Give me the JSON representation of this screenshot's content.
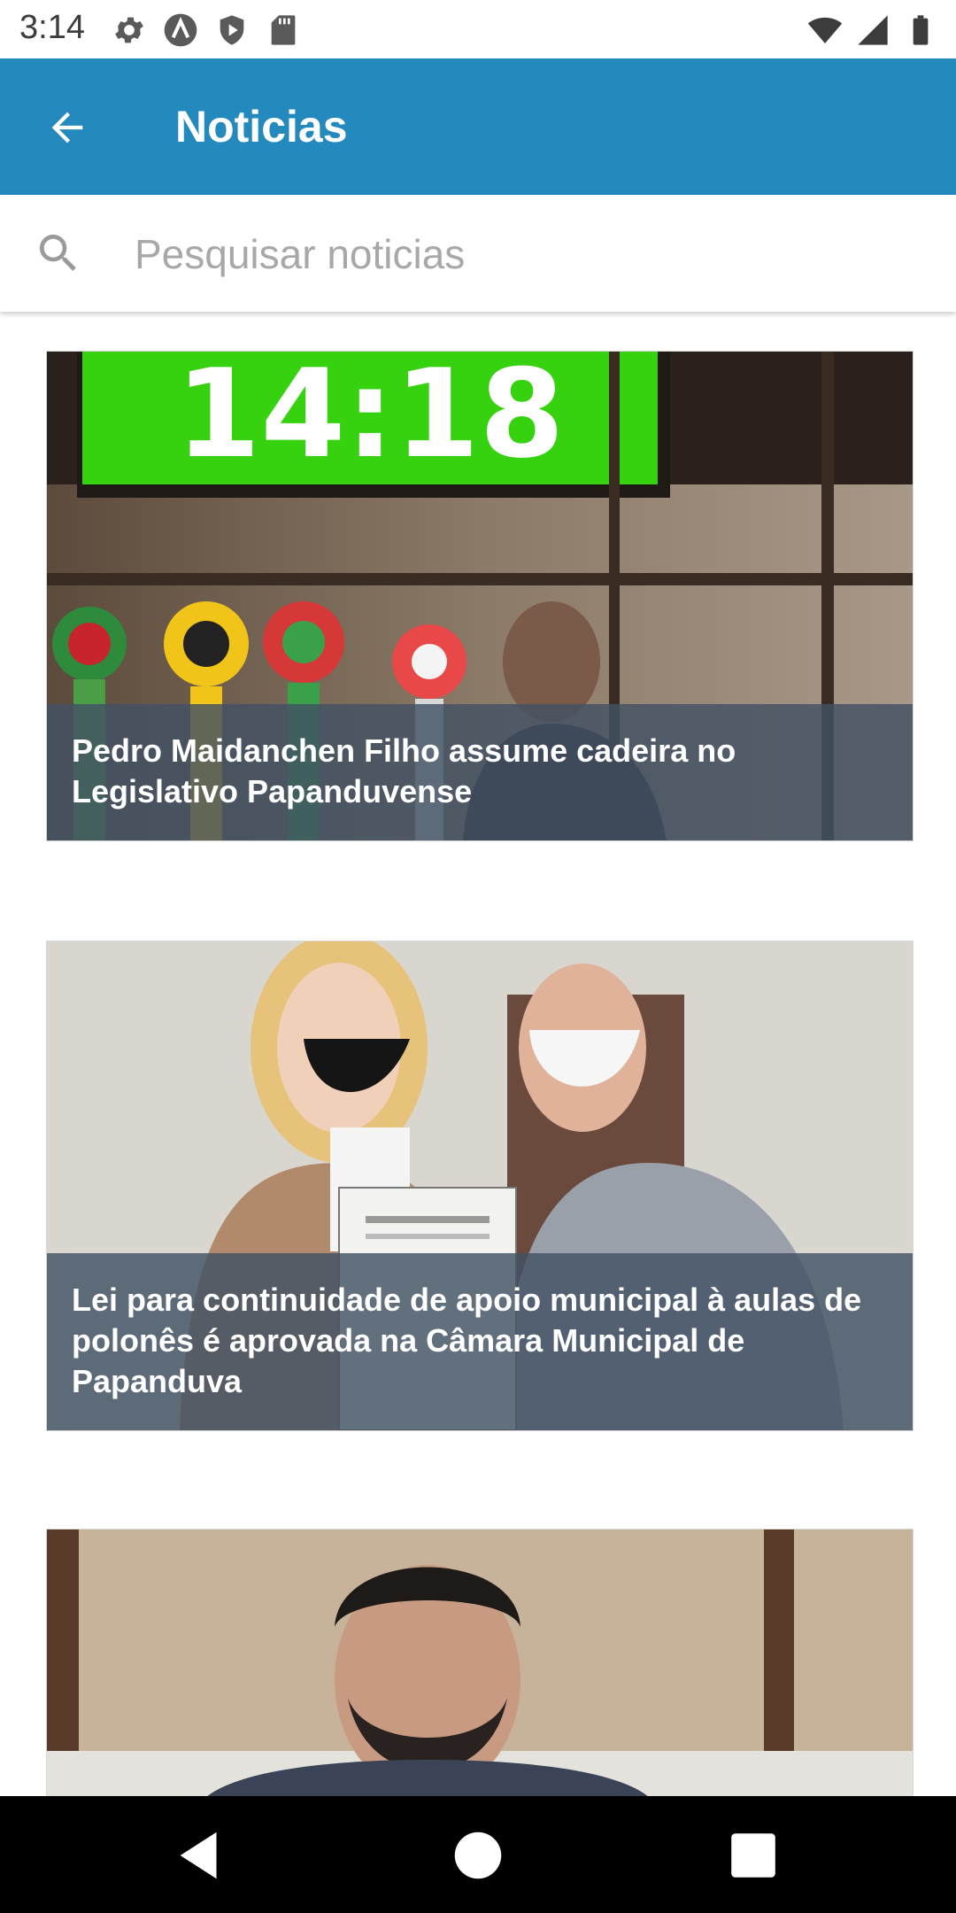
{
  "status_bar": {
    "time": "3:14",
    "left_icons": [
      "settings-icon",
      "a-icon",
      "play-protect-icon",
      "sd-card-icon"
    ],
    "right_icons": [
      "wifi-icon",
      "signal-icon",
      "battery-icon"
    ]
  },
  "app_bar": {
    "title": "Noticias",
    "back_icon": "arrow-back-icon",
    "color": "#2489bd"
  },
  "search": {
    "placeholder": "Pesquisar noticias",
    "value": ""
  },
  "news": [
    {
      "title": "Pedro Maidanchen Filho assume cadeira no Legislativo Papanduvense"
    },
    {
      "title": "Lei para continuidade de apoio municipal à aulas de polonês é aprovada na Câmara Municipal de Papanduva"
    },
    {
      "title": ""
    }
  ],
  "photo_text": {
    "clock_display": "14:18"
  },
  "nav_bar": {
    "buttons": [
      "back-triangle-icon",
      "home-circle-icon",
      "recents-square-icon"
    ]
  }
}
